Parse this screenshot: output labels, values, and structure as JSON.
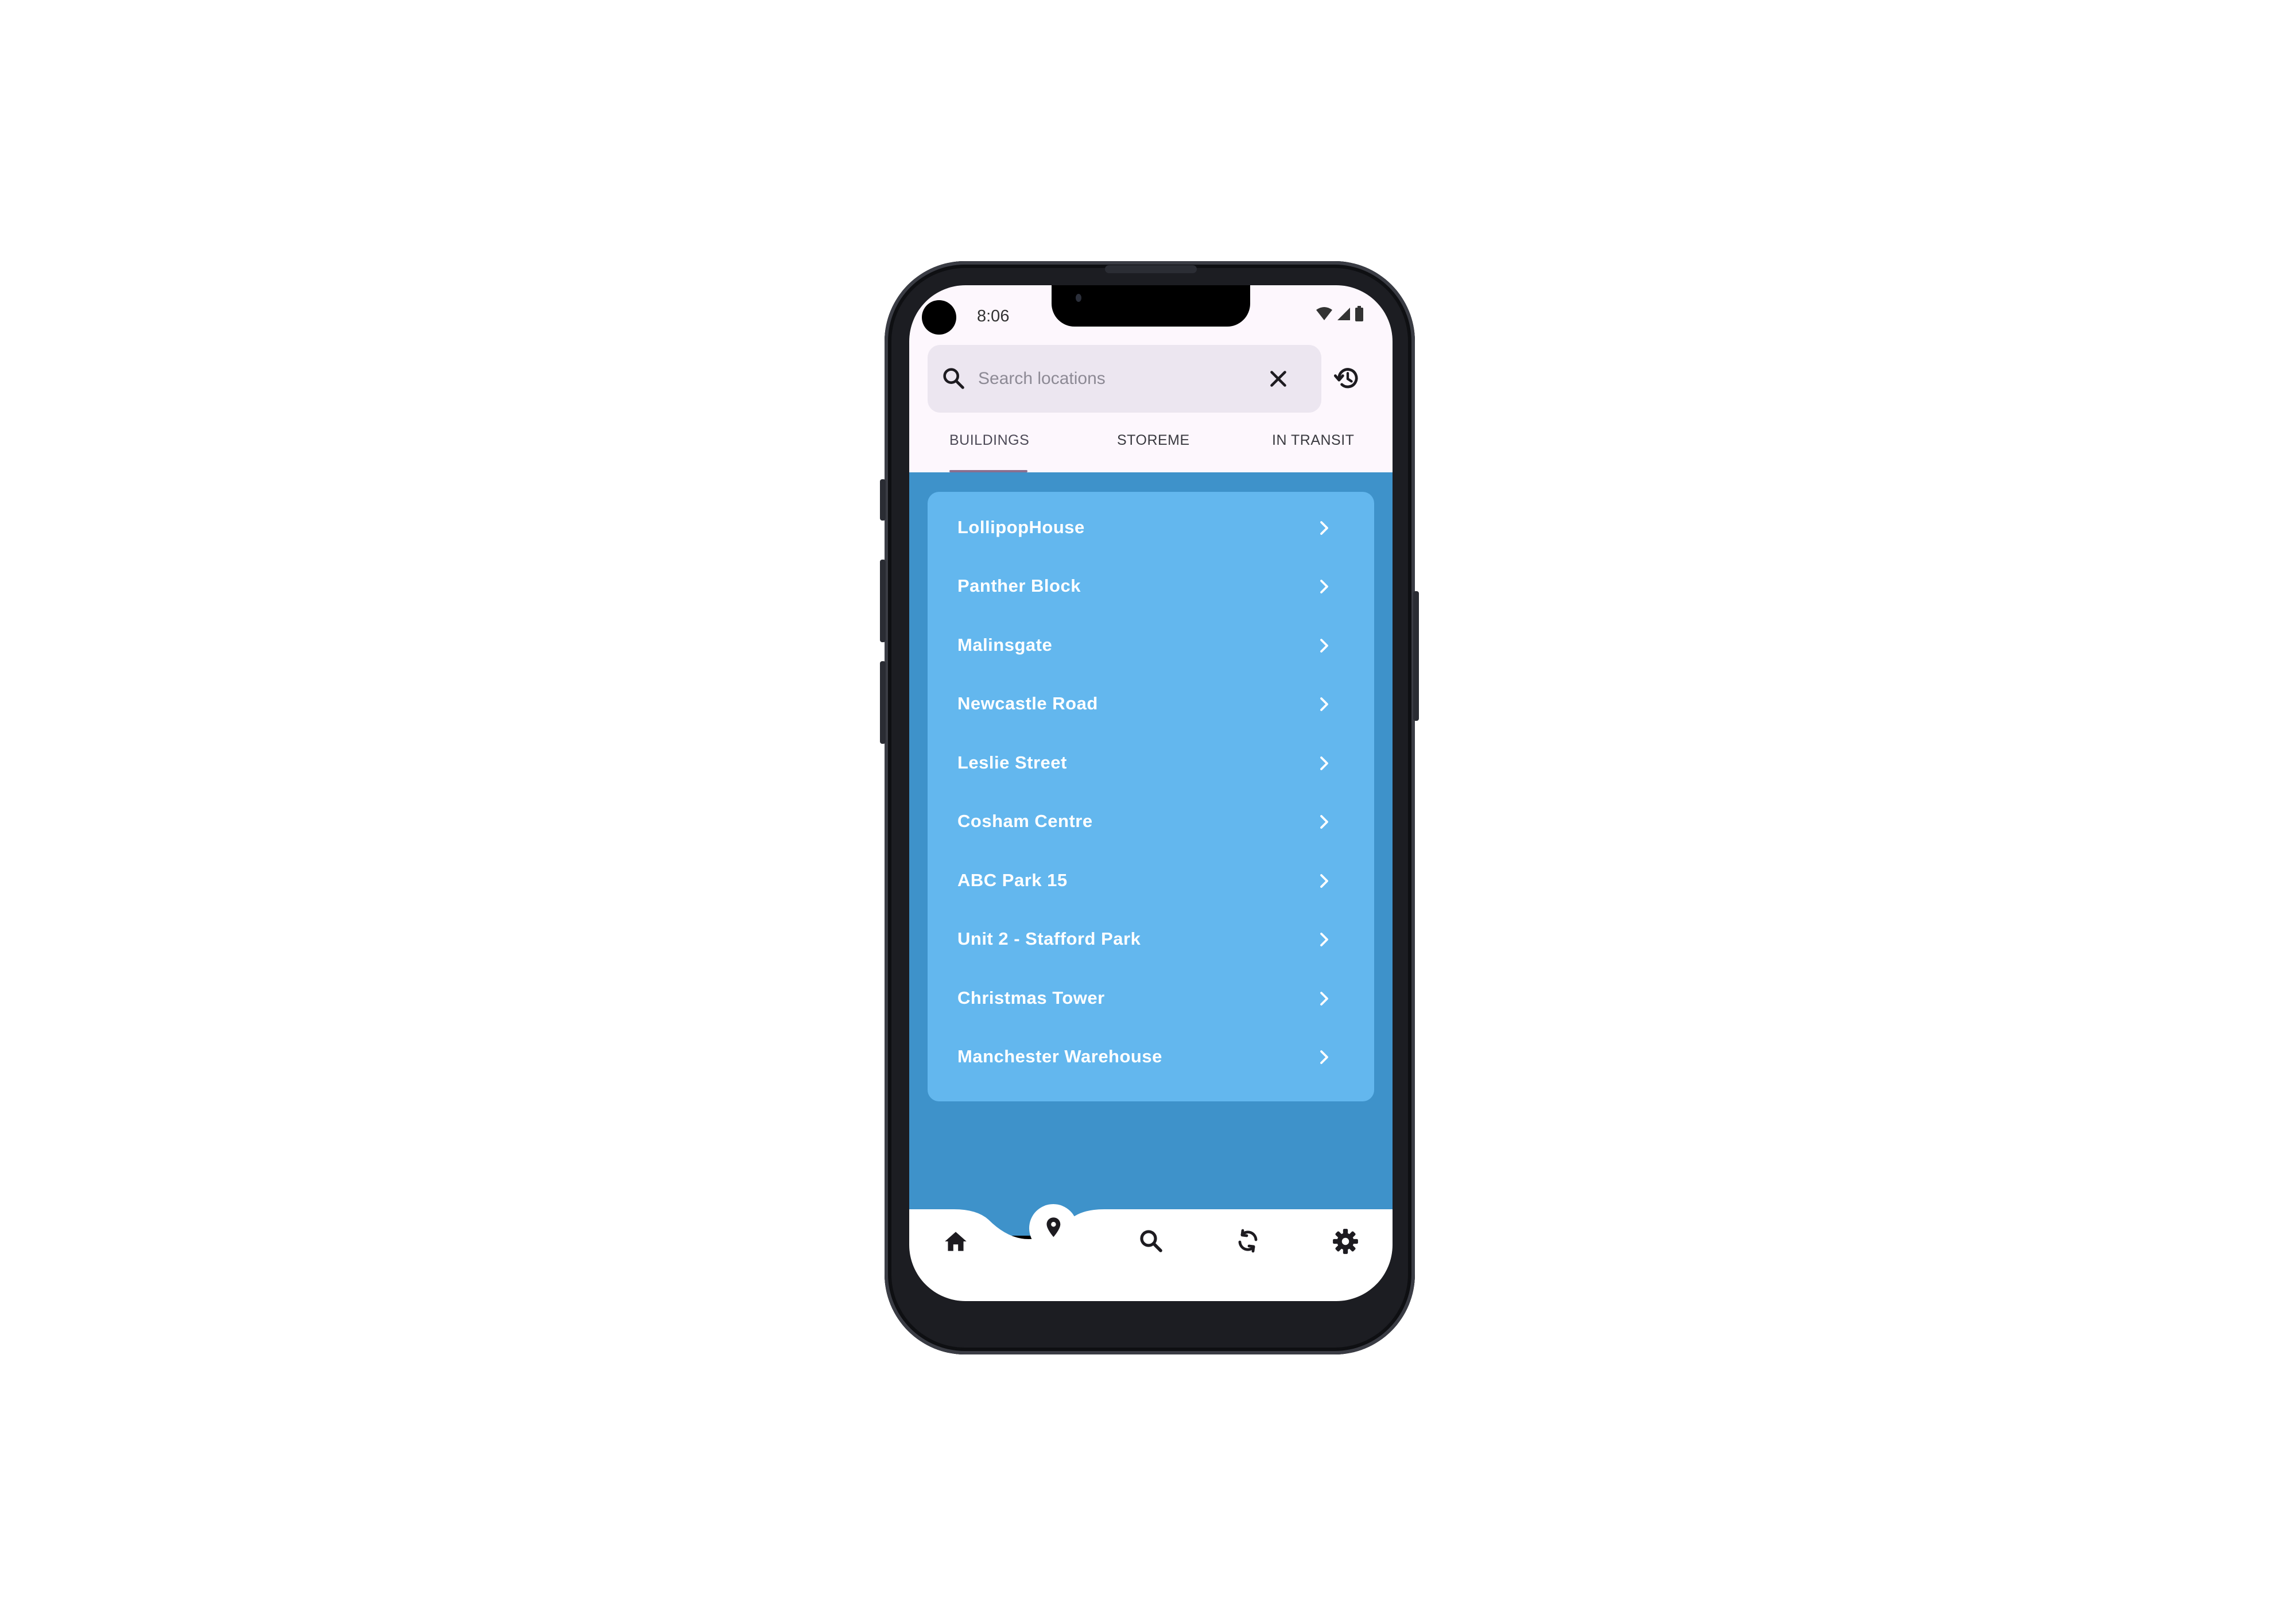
{
  "status_bar": {
    "time": "8:06",
    "icons": [
      "wifi-icon",
      "signal-icon",
      "battery-icon"
    ]
  },
  "search": {
    "placeholder": "Search locations",
    "value": "",
    "leading_icon": "search-icon",
    "clear_icon": "close-icon",
    "history_icon": "history-icon"
  },
  "tabs": [
    {
      "label": "BUILDINGS",
      "active": true
    },
    {
      "label": "STOREME",
      "active": false
    },
    {
      "label": "IN TRANSIT",
      "active": false
    }
  ],
  "buildings": [
    {
      "name": "LollipopHouse"
    },
    {
      "name": "Panther Block"
    },
    {
      "name": "Malinsgate"
    },
    {
      "name": "Newcastle Road"
    },
    {
      "name": "Leslie Street"
    },
    {
      "name": "Cosham Centre"
    },
    {
      "name": "ABC Park 15"
    },
    {
      "name": "Unit 2 - Stafford Park"
    },
    {
      "name": "Christmas Tower"
    },
    {
      "name": "Manchester Warehouse"
    }
  ],
  "bottom_nav": [
    {
      "icon": "home-icon",
      "active": false
    },
    {
      "icon": "location-pin-icon",
      "active": true
    },
    {
      "icon": "search-icon",
      "active": false
    },
    {
      "icon": "sync-icon",
      "active": false
    },
    {
      "icon": "settings-icon",
      "active": false
    }
  ],
  "colors": {
    "app_background": "#3e92ca",
    "card_background": "#63b7ee",
    "header_background": "#fdf7fd",
    "search_background": "#ece6f0",
    "tab_indicator": "#8a6f8f",
    "list_text": "#ffffff",
    "nav_background": "#ffffff"
  }
}
